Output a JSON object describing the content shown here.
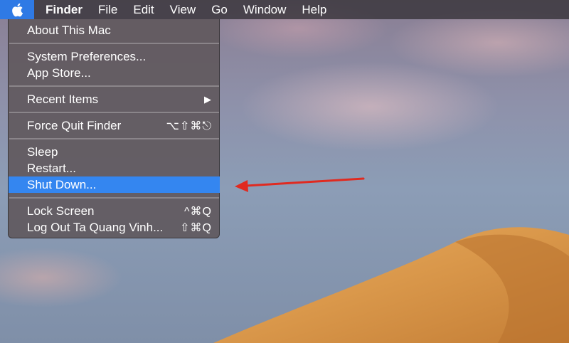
{
  "menubar": {
    "items": [
      "Finder",
      "File",
      "Edit",
      "View",
      "Go",
      "Window",
      "Help"
    ]
  },
  "apple_menu": {
    "about": "About This Mac",
    "system_prefs": "System Preferences...",
    "app_store": "App Store...",
    "recent_items": "Recent Items",
    "recent_items_arrow": "▶",
    "force_quit": "Force Quit Finder",
    "force_quit_shortcut": "⌥⇧⌘⎋",
    "sleep": "Sleep",
    "restart": "Restart...",
    "shut_down": "Shut Down...",
    "lock_screen": "Lock Screen",
    "lock_screen_shortcut": "^⌘Q",
    "log_out": "Log Out Ta Quang Vinh...",
    "log_out_shortcut": "⇧⌘Q"
  },
  "colors": {
    "highlight": "#3486f0",
    "annotation_arrow": "#e02a20"
  }
}
